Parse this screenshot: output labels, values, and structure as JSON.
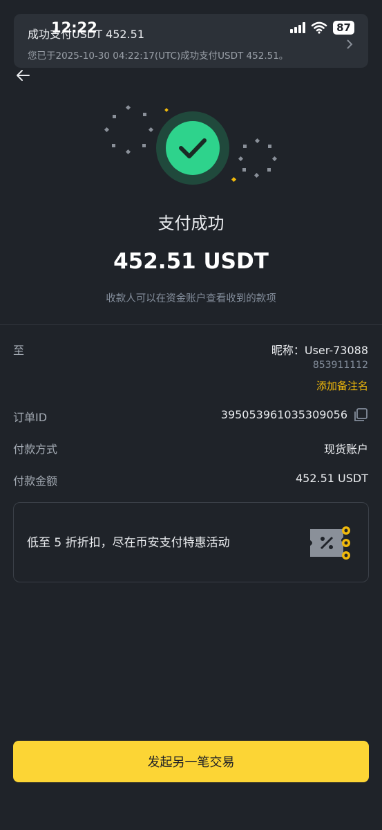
{
  "status_bar": {
    "time": "12:22",
    "battery": "87"
  },
  "notification": {
    "title": "成功支付USDT 452.51",
    "body": "您已于2025-10-30 04:22:17(UTC)成功支付USDT 452.51。"
  },
  "result": {
    "title": "支付成功",
    "amount": "452.51 USDT",
    "note": "收款人可以在资金账户查看收到的款项"
  },
  "details": {
    "to_label": "至",
    "nickname": "昵称：User-73088",
    "user_id": "853911112",
    "add_remark": "添加备注名",
    "order_label": "订单ID",
    "order_id": "395053961035309056",
    "method_label": "付款方式",
    "method_value": "现货账户",
    "amount_label": "付款金额",
    "amount_value": "452.51 USDT"
  },
  "promo": {
    "text": "低至 5 折折扣，尽在币安支付特惠活动"
  },
  "cta": {
    "label": "发起另一笔交易"
  },
  "colors": {
    "accent": "#fcd535",
    "success": "#2ed38c",
    "background": "#1f2329",
    "link": "#f0b90b"
  },
  "icons": [
    "back-arrow-icon",
    "check-icon",
    "copy-icon",
    "discount-ticket-icon",
    "chevron-right-icon",
    "wifi-icon",
    "signal-icon"
  ]
}
